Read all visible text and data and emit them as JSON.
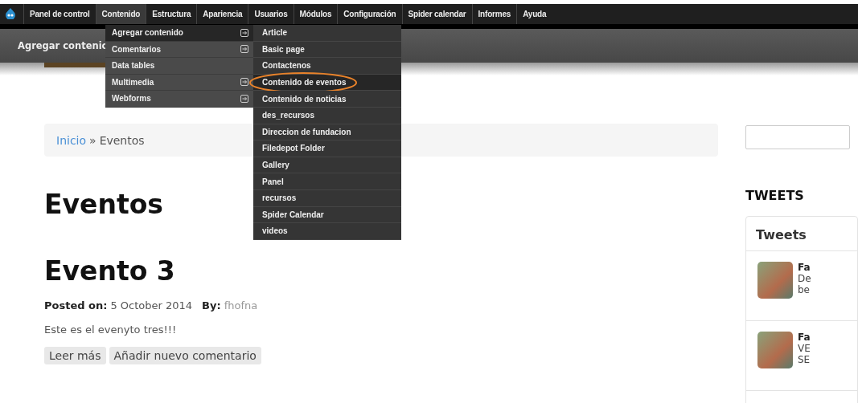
{
  "admin_menu": {
    "items": [
      {
        "label": "Panel de control",
        "selected": false
      },
      {
        "label": "Contenido",
        "selected": true
      },
      {
        "label": "Estructura",
        "selected": false
      },
      {
        "label": "Apariencia",
        "selected": false
      },
      {
        "label": "Usuarios",
        "selected": false
      },
      {
        "label": "Módulos",
        "selected": false
      },
      {
        "label": "Configuración",
        "selected": false
      },
      {
        "label": "Spider calendar",
        "selected": false
      },
      {
        "label": "Informes",
        "selected": false
      },
      {
        "label": "Ayuda",
        "selected": false
      }
    ]
  },
  "shortcut_bar": {
    "label": "Agregar contenic"
  },
  "dropdown": {
    "items": [
      {
        "label": "Agregar contenido",
        "has_submenu": true,
        "selected": true
      },
      {
        "label": "Comentarios",
        "has_submenu": true,
        "selected": false
      },
      {
        "label": "Data tables",
        "has_submenu": false,
        "selected": false
      },
      {
        "label": "Multimedia",
        "has_submenu": true,
        "selected": false
      },
      {
        "label": "Webforms",
        "has_submenu": true,
        "selected": false
      }
    ],
    "submenu": {
      "items": [
        {
          "label": "Article",
          "selected": false,
          "circled": false
        },
        {
          "label": "Basic page",
          "selected": false,
          "circled": false
        },
        {
          "label": "Contactenos",
          "selected": false,
          "circled": false
        },
        {
          "label": "Contenido de eventos",
          "selected": true,
          "circled": true
        },
        {
          "label": "Contenido de noticias",
          "selected": false,
          "circled": false
        },
        {
          "label": "des_recursos",
          "selected": false,
          "circled": false
        },
        {
          "label": "Direccion de fundacion",
          "selected": false,
          "circled": false
        },
        {
          "label": "Filedepot Folder",
          "selected": false,
          "circled": false
        },
        {
          "label": "Gallery",
          "selected": false,
          "circled": false
        },
        {
          "label": "Panel",
          "selected": false,
          "circled": false
        },
        {
          "label": "recursos",
          "selected": false,
          "circled": false
        },
        {
          "label": "Spider Calendar",
          "selected": false,
          "circled": false
        },
        {
          "label": "videos",
          "selected": false,
          "circled": false
        }
      ]
    }
  },
  "breadcrumb": {
    "link": "Inicio",
    "separator": "»",
    "current": "Eventos"
  },
  "page_title": "Eventos",
  "article": {
    "title": "Evento 3",
    "posted_label": "Posted on:",
    "date": "5 October 2014",
    "by_label": "By:",
    "author": "fhofna",
    "body": "Este es el evenyto tres!!!",
    "links": [
      "Leer más",
      "Añadir nuevo comentario"
    ]
  },
  "sidebar": {
    "heading": "TWEETS",
    "widget_title": "Tweets",
    "tweets": [
      {
        "name": "Fa",
        "lines": [
          "De",
          "be"
        ]
      },
      {
        "name": "Fa",
        "lines": [
          "VE",
          "SE"
        ]
      }
    ]
  }
}
